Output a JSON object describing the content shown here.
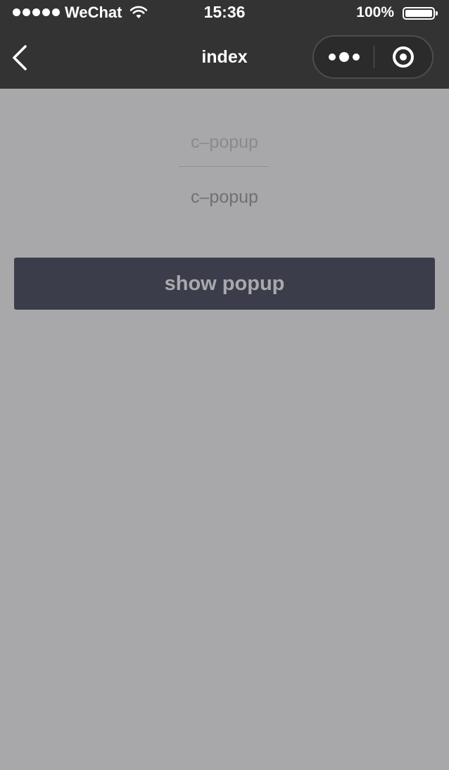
{
  "status_bar": {
    "carrier": "WeChat",
    "time": "15:36",
    "battery_percent": "100%"
  },
  "navbar": {
    "title": "index"
  },
  "page": {
    "component_title": "c–popup",
    "component_subtitle": "c–popup",
    "show_button_label": "show popup"
  },
  "icons": {
    "back": "chevron-left-icon",
    "more": "more-dots-icon",
    "close": "target-close-icon",
    "wifi": "wifi-icon",
    "battery": "battery-icon"
  },
  "colors": {
    "navbar_bg": "#333333",
    "page_bg": "#a8a8aa",
    "button_bg": "#3c3d4a",
    "button_text": "#a9a9ad"
  }
}
